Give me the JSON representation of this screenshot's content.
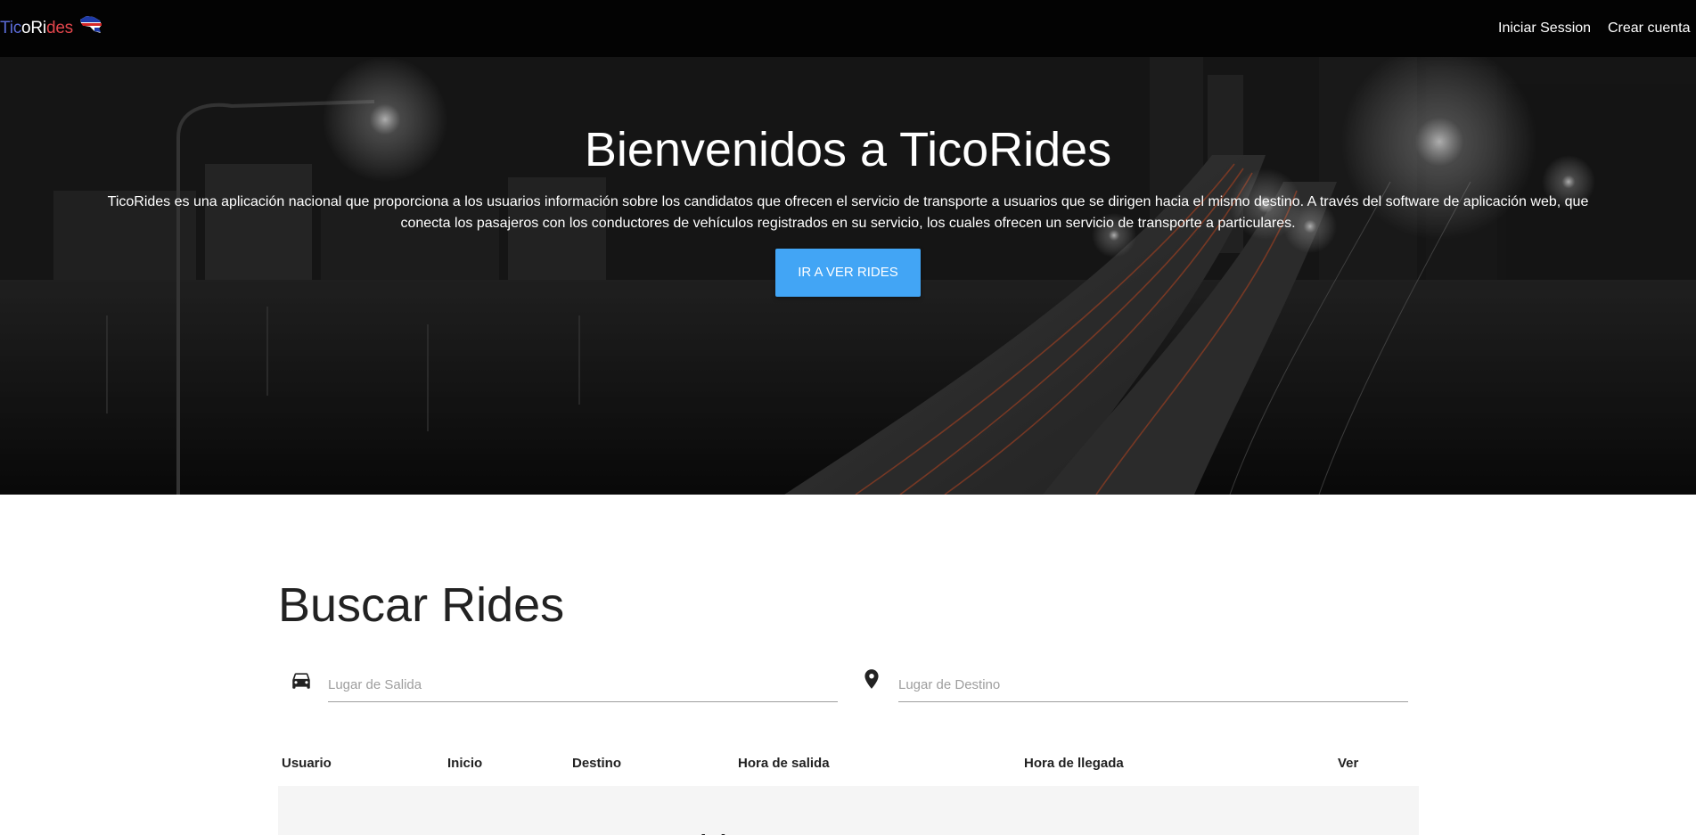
{
  "navbar": {
    "brand_parts": [
      "Tic",
      "oRi",
      "des"
    ],
    "brand_colors": [
      "#5a6ad6",
      "#ffffff",
      "#e0454b"
    ],
    "flag_icon": "costa-rica-map-flag-icon",
    "links": {
      "login": "Iniciar Session",
      "register": "Crear cuenta"
    }
  },
  "hero": {
    "title": "Bienvenidos a TicoRides",
    "description": "TicoRides es una aplicación nacional que proporciona a los usuarios información sobre los candidatos que ofrecen el servicio de transporte a usuarios que se dirigen hacia el mismo destino. A través del software de aplicación web, que conecta los pasajeros con los conductores de vehículos registrados en su servicio, los cuales ofrecen un servicio de transporte a particulares.",
    "button_label": "IR A VER RIDES",
    "button_color": "#42a5f5"
  },
  "search": {
    "title": "Buscar Rides",
    "origin": {
      "icon": "car-icon",
      "placeholder": "Lugar de Salida",
      "value": ""
    },
    "destination": {
      "icon": "location-pin-icon",
      "placeholder": "Lugar de Destino",
      "value": ""
    }
  },
  "table": {
    "headers": [
      "Usuario",
      "Inicio",
      "Destino",
      "Hora de salida",
      "Hora de llegada",
      "Ver"
    ],
    "empty_message": "... ride..."
  }
}
